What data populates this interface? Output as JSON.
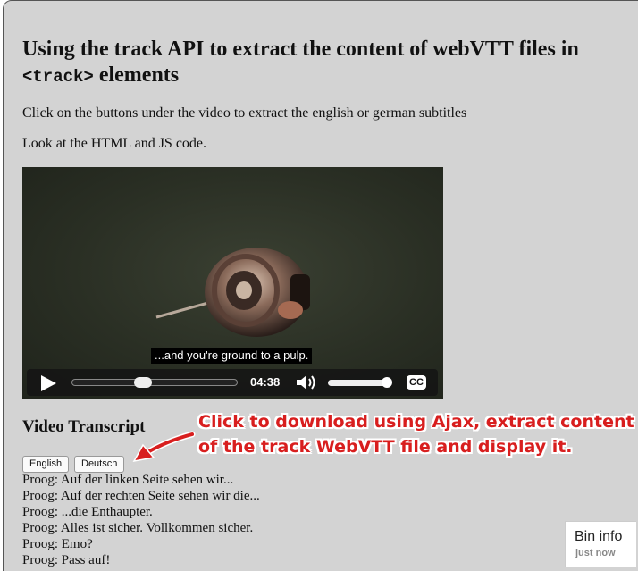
{
  "heading": {
    "text_before": "Using the track API to extract the content of webVTT files in",
    "code": "<track>",
    "text_after": "elements"
  },
  "intro": "Click on the buttons under the video to extract the english or german subtitles",
  "note": "Look at the HTML and JS code.",
  "video": {
    "subtitle": "...and you're ground to a pulp.",
    "time": "04:38",
    "progress": 0.42,
    "volume": 1.0,
    "cc_label": "CC"
  },
  "transcript": {
    "title": "Video Transcript",
    "buttons": {
      "english": "English",
      "deutsch": "Deutsch"
    },
    "lines": [
      "Proog: Auf der linken Seite sehen wir...",
      "Proog: Auf der rechten Seite sehen wir die...",
      "Proog: ...die Enthaupter.",
      "Proog: Alles ist sicher. Vollkommen sicher.",
      "Proog: Emo?",
      "Proog: Pass auf!"
    ]
  },
  "annotation": {
    "line1": "Click to download using Ajax, extract content",
    "line2": "of the track WebVTT file and display it."
  },
  "bin_info": {
    "title": "Bin info",
    "subtitle": "just now"
  },
  "colors": {
    "panel_bg": "#d3d3d3",
    "annotation_red": "#d81e1e"
  }
}
